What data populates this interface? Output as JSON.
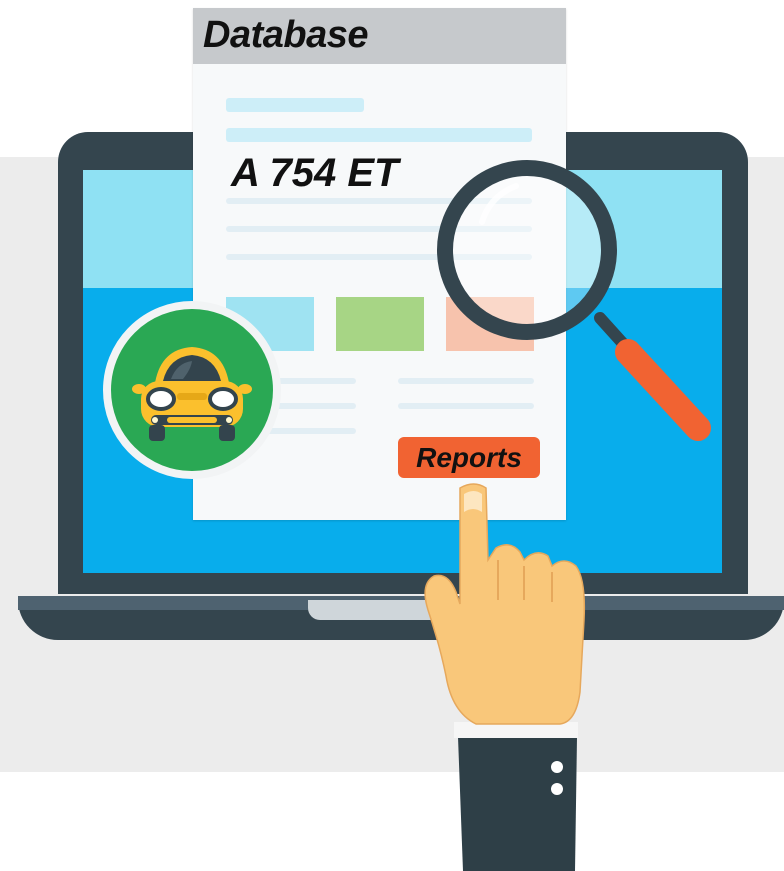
{
  "document": {
    "title": "Database",
    "plate_number": "A 754 ET"
  },
  "button": {
    "reports_label": "Reports"
  },
  "colors": {
    "background_band": "#ececec",
    "laptop_frame": "#34454e",
    "screen": "#08adec",
    "screen_top": "#8fe1f3",
    "document_header": "#c6c9cc",
    "reports_button": "#f16332",
    "car_badge": "#2aa854",
    "car": "#fbc02d",
    "magnifier_handle": "#f16332",
    "hand": "#f9c77a",
    "sleeve": "#2e3f47"
  },
  "icons": [
    "car-icon",
    "magnifier-icon",
    "pointing-hand-icon"
  ]
}
